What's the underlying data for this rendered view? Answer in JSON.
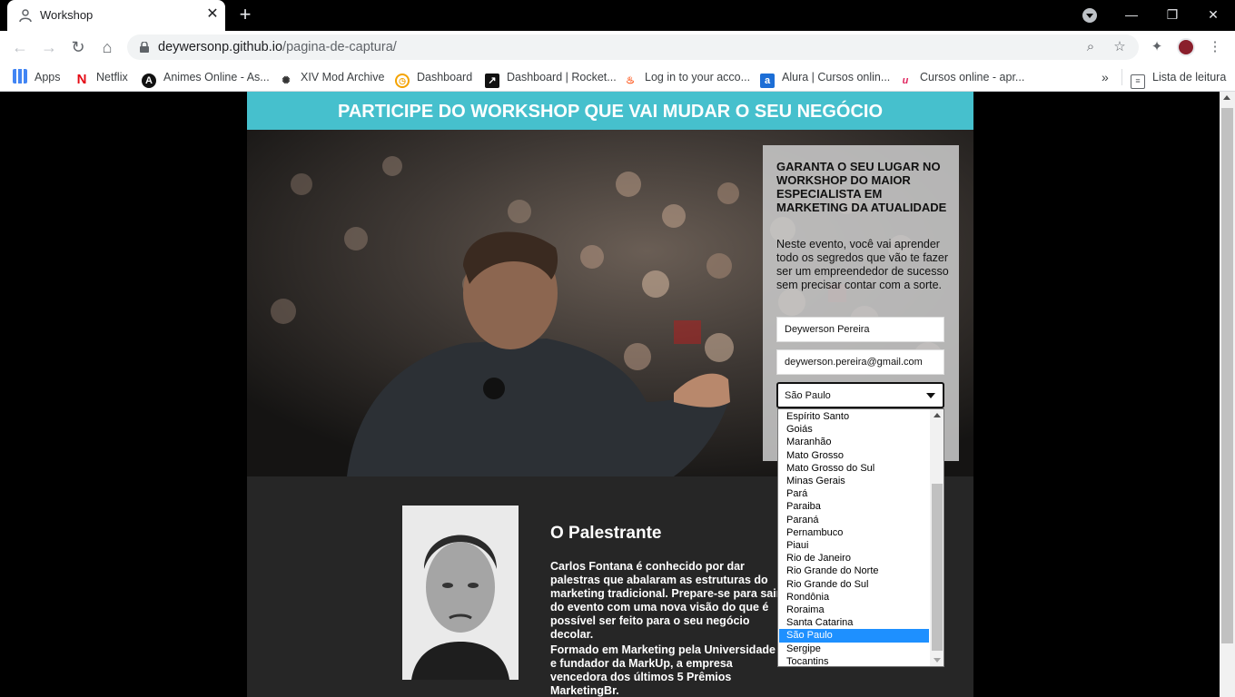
{
  "browser": {
    "tab_title": "Workshop",
    "url_host": "deywersonp.github.io",
    "url_path": "/pagina-de-captura/",
    "bookmarks": [
      {
        "label": "Apps",
        "icon": "apps-grid-icon"
      },
      {
        "label": "Netflix",
        "icon": "netflix-icon"
      },
      {
        "label": "Animes Online - As...",
        "icon": "anime-icon"
      },
      {
        "label": "XIV Mod Archive",
        "icon": "mod-archive-icon"
      },
      {
        "label": "Dashboard",
        "icon": "dashboard-icon"
      },
      {
        "label": "Dashboard | Rocket...",
        "icon": "rocketseat-icon"
      },
      {
        "label": "Log in to your acco...",
        "icon": "flame-icon"
      },
      {
        "label": "Alura | Cursos onlin...",
        "icon": "alura-icon"
      },
      {
        "label": "Cursos online - apr...",
        "icon": "udemy-icon"
      }
    ],
    "reading_list": "Lista de leitura"
  },
  "page": {
    "banner": "PARTICIPE DO WORKSHOP QUE VAI MUDAR O SEU NEGÓCIO",
    "form": {
      "title": "GARANTA O SEU LUGAR NO WORKSHOP DO MAIOR ESPECIALISTA EM MARKETING DA ATUALIDADE",
      "text": "Neste evento, você vai aprender todo os segredos que vão te fazer ser um empreendedor de sucesso sem precisar contar com a sorte.",
      "name_value": "Deywerson Pereira",
      "email_value": "deywerson.pereira@gmail.com",
      "state_value": "São Paulo"
    },
    "about": {
      "title": "O Palestrante",
      "p1": "Carlos Fontana é conhecido por dar palestras que abalaram as estruturas do marketing tradicional. Prepare-se para sair do evento com uma nova visão do que é possível ser feito para o seu negócio decolar.",
      "p2": "Formado em Marketing pela Universidade X e fundador da MarkUp, a empresa vencedora dos últimos 5 Prêmios MarketingBr."
    },
    "state_options": [
      "Espírito Santo",
      "Goiás",
      "Maranhão",
      "Mato Grosso",
      "Mato Grosso do Sul",
      "Minas Gerais",
      "Pará",
      "Paraiba",
      "Paraná",
      "Pernambuco",
      "Piaui",
      "Rio de Janeiro",
      "Rio Grande do Norte",
      "Rio Grande do Sul",
      "Rondônia",
      "Roraima",
      "Santa Catarina",
      "São Paulo",
      "Sergipe",
      "Tocantins"
    ],
    "selected_option": "São Paulo"
  },
  "colors": {
    "banner": "#46c0cd",
    "selected_option": "#1e90ff",
    "about_bg": "#262626"
  }
}
